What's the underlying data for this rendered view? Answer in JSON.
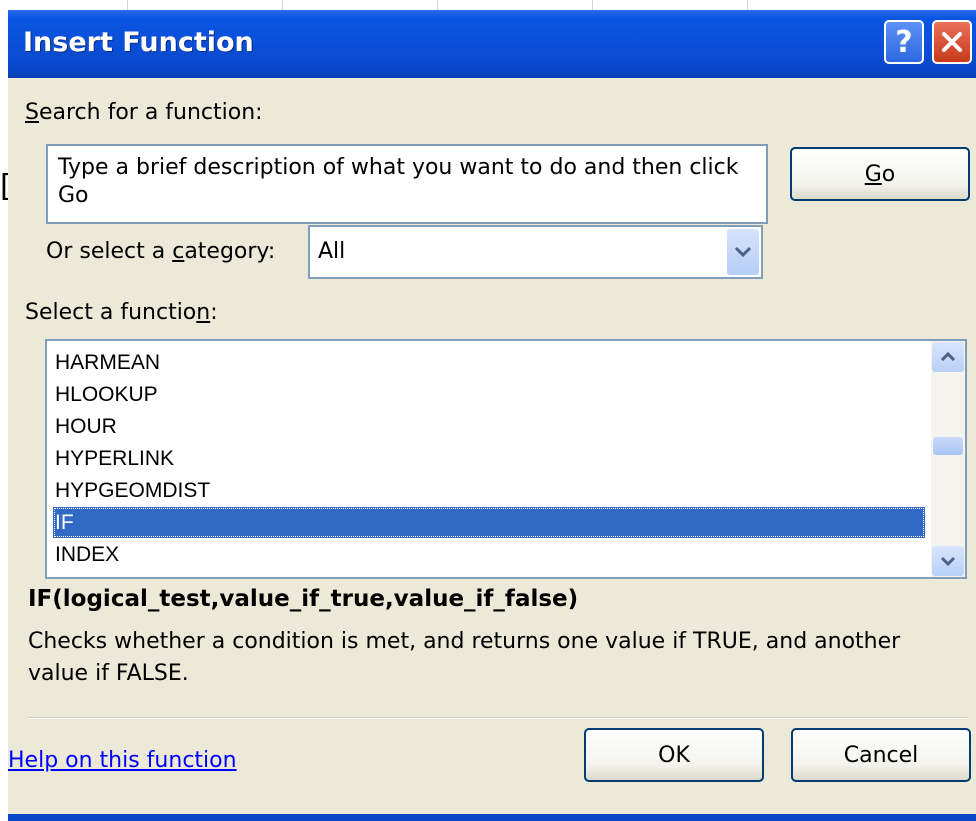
{
  "dialog": {
    "title": "Insert Function",
    "help_button": "?"
  },
  "search": {
    "label_access_key": "S",
    "label_rest": "earch for a function:",
    "text": "Type a brief description of what you want to do and then click Go",
    "go_prefix": "",
    "go_access_key": "G",
    "go_rest": "o"
  },
  "category": {
    "label_before": "Or select a ",
    "label_access_key": "c",
    "label_after": "ategory:",
    "selected": "All"
  },
  "function_list": {
    "label_before": "Select a functio",
    "label_access_key": "n",
    "label_after": ":",
    "items": [
      "HARMEAN",
      "HLOOKUP",
      "HOUR",
      "HYPERLINK",
      "HYPGEOMDIST",
      "IF",
      "INDEX"
    ],
    "selected": "IF"
  },
  "details": {
    "signature": "IF(logical_test,value_if_true,value_if_false)",
    "description": "Checks whether a condition is met, and returns one value if TRUE, and another value if FALSE."
  },
  "footer": {
    "help_link": "Help on this function",
    "ok": "OK",
    "cancel": "Cancel"
  },
  "colors": {
    "title_bar": "#0a55e2",
    "dialog_bg": "#ece9d8",
    "selection": "#316ac5",
    "link": "#0000ff"
  }
}
